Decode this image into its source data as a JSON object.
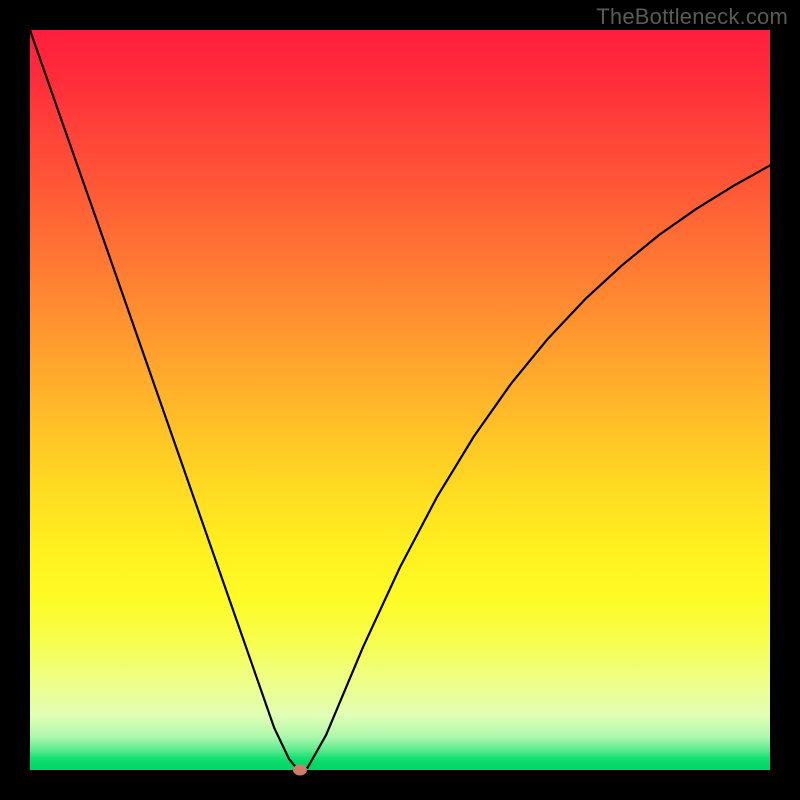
{
  "watermark": "TheBottleneck.com",
  "colors": {
    "gradient_top": "#ff1f3e",
    "gradient_mid": "#ffe21f",
    "gradient_bottom": "#02d764",
    "curve": "#000000",
    "marker": "#cf7a6a",
    "background": "#000000"
  },
  "chart_data": {
    "type": "line",
    "title": "",
    "xlabel": "",
    "ylabel": "",
    "xlim": [
      0,
      100
    ],
    "ylim": [
      0,
      100
    ],
    "series": [
      {
        "name": "curve",
        "x": [
          0,
          5,
          10,
          15,
          20,
          25,
          30,
          33,
          35,
          36,
          36.5,
          37.5,
          40,
          45,
          50,
          55,
          60,
          65,
          70,
          75,
          80,
          85,
          90,
          95,
          100
        ],
        "values": [
          100,
          85.7,
          71.5,
          57.2,
          42.9,
          28.6,
          14.3,
          5.7,
          1.5,
          0.3,
          0.0,
          0.3,
          4.7,
          16.6,
          27.4,
          36.9,
          45.1,
          52.2,
          58.3,
          63.6,
          68.2,
          72.3,
          75.8,
          78.9,
          81.7
        ]
      }
    ],
    "marker": {
      "x": 36.5,
      "y": 0.0
    },
    "annotations": []
  }
}
